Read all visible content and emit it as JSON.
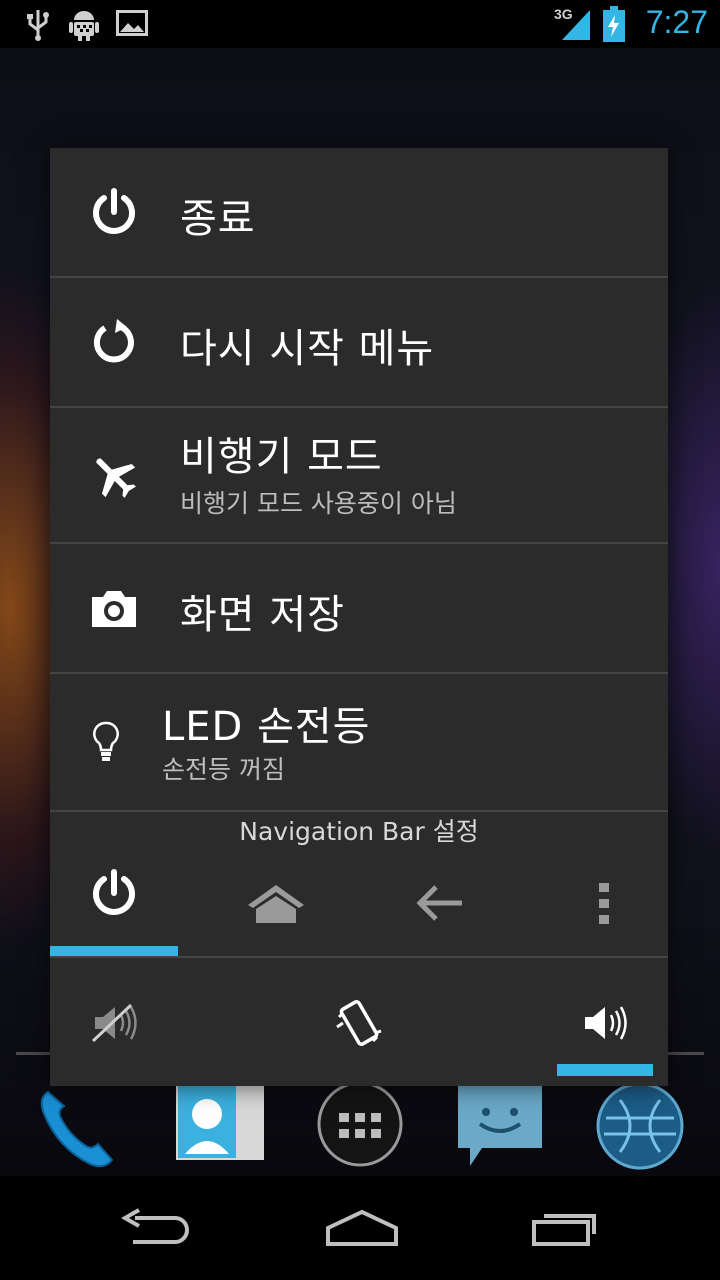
{
  "status_bar": {
    "time": "7:27",
    "network": "3G",
    "icons": [
      "usb-icon",
      "android-debug-icon",
      "image-notification-icon",
      "signal-icon",
      "battery-charging-icon"
    ]
  },
  "power_menu": {
    "items": [
      {
        "icon": "power-icon",
        "title": "종료"
      },
      {
        "icon": "restart-icon",
        "title": "다시 시작 메뉴"
      },
      {
        "icon": "airplane-icon",
        "title": "비행기 모드",
        "subtitle": "비행기 모드 사용중이 아님"
      },
      {
        "icon": "camera-icon",
        "title": "화면 저장"
      },
      {
        "icon": "lightbulb-icon",
        "title": "LED 손전등",
        "subtitle": "손전등 꺼짐"
      }
    ],
    "navbar_section_label": "Navigation Bar 설정",
    "navbar_options": [
      "power-icon",
      "home-icon",
      "back-arrow-icon",
      "overflow-menu-icon"
    ],
    "navbar_selected_index": 0,
    "sound_options": [
      "silent-icon",
      "vibrate-icon",
      "sound-on-icon"
    ],
    "sound_selected_index": 2
  },
  "colors": {
    "accent": "#33b5e5",
    "dialog_bg": "#2b2b2b",
    "divider": "#444444"
  }
}
